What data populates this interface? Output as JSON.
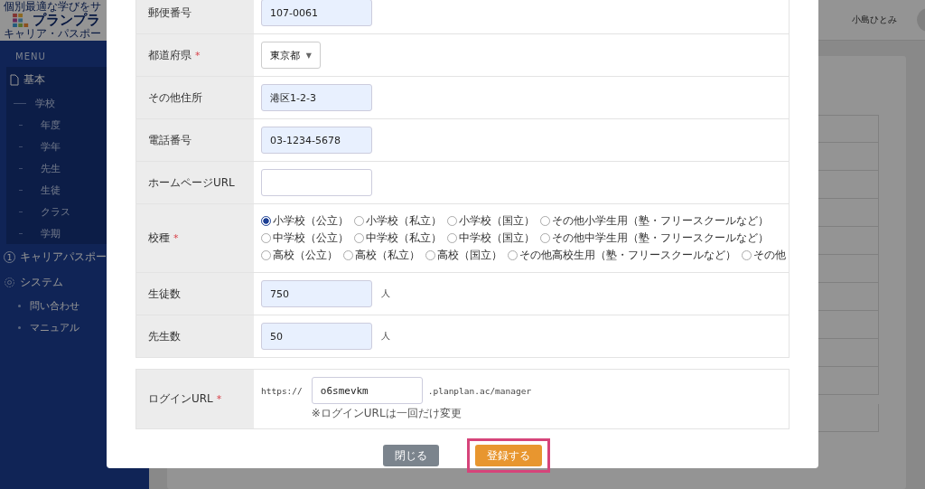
{
  "brand": {
    "tagline": "個別最適な学びをサ",
    "name": "プランプラ",
    "subtitle": "キャリア・パスポー"
  },
  "sidebar": {
    "heading": "MENU",
    "items": [
      {
        "label": "基本",
        "expanded": true,
        "children": [
          {
            "label": "学校",
            "kind": "section"
          },
          {
            "label": "年度",
            "kind": "item"
          },
          {
            "label": "学年",
            "kind": "item"
          },
          {
            "label": "先生",
            "kind": "item"
          },
          {
            "label": "生徒",
            "kind": "item"
          },
          {
            "label": "クラス",
            "kind": "item"
          },
          {
            "label": "学期",
            "kind": "item"
          }
        ]
      },
      {
        "label": "キャリアパスポー",
        "number": "1"
      },
      {
        "label": "システム",
        "expanded": true,
        "children": [
          {
            "label": "問い合わせ",
            "kind": "bullet"
          },
          {
            "label": "マニュアル",
            "kind": "bullet"
          }
        ]
      }
    ]
  },
  "header": {
    "user": "小島ひとみ"
  },
  "modal": {
    "rows": [
      {
        "label": "郵便番号",
        "kind": "input",
        "value": "107-0061",
        "highlighted": true
      },
      {
        "label": "都道府県",
        "mark": "*",
        "kind": "select",
        "value": "東京都",
        "caret": "▼"
      },
      {
        "label": "その他住所",
        "kind": "input",
        "value": "港区1-2-3",
        "highlighted": true
      },
      {
        "label": "電話番号",
        "kind": "input",
        "value": "03-1234-5678",
        "highlighted": true
      },
      {
        "label": "ホームページURL",
        "kind": "input",
        "value": "",
        "highlighted": false
      },
      {
        "label": "校種",
        "mark": "*",
        "kind": "radio",
        "option_rows": [
          [
            {
              "label": "小学校（公立）",
              "selected": true
            },
            {
              "label": "小学校（私立）",
              "selected": false
            },
            {
              "label": "小学校（国立）",
              "selected": false
            },
            {
              "label": "その他小学生用（塾・フリースクールなど）",
              "selected": false
            }
          ],
          [
            {
              "label": "中学校（公立）",
              "selected": false
            },
            {
              "label": "中学校（私立）",
              "selected": false
            },
            {
              "label": "中学校（国立）",
              "selected": false
            },
            {
              "label": "その他中学生用（塾・フリースクールなど）",
              "selected": false
            }
          ],
          [
            {
              "label": "高校（公立）",
              "selected": false
            },
            {
              "label": "高校（私立）",
              "selected": false
            },
            {
              "label": "高校（国立）",
              "selected": false
            },
            {
              "label": "その他高校生用（塾・フリースクールなど）",
              "selected": false
            },
            {
              "label": "その他",
              "selected": false
            }
          ]
        ]
      },
      {
        "label": "生徒数",
        "kind": "input",
        "value": "750",
        "highlighted": true,
        "unit": "人"
      },
      {
        "label": "先生数",
        "kind": "input",
        "value": "50",
        "highlighted": true,
        "unit": "人"
      }
    ],
    "login": {
      "label": "ログインURL",
      "mark": "*",
      "prefix": "https://",
      "value": "o6smevkm",
      "suffix": ".planplan.ac/manager",
      "note": "※ログインURLは一回だけ変更"
    },
    "buttons": [
      {
        "label": "閉じる",
        "kind": "secondary",
        "framed": false
      },
      {
        "label": "登録する",
        "kind": "primary",
        "framed": true
      }
    ]
  }
}
